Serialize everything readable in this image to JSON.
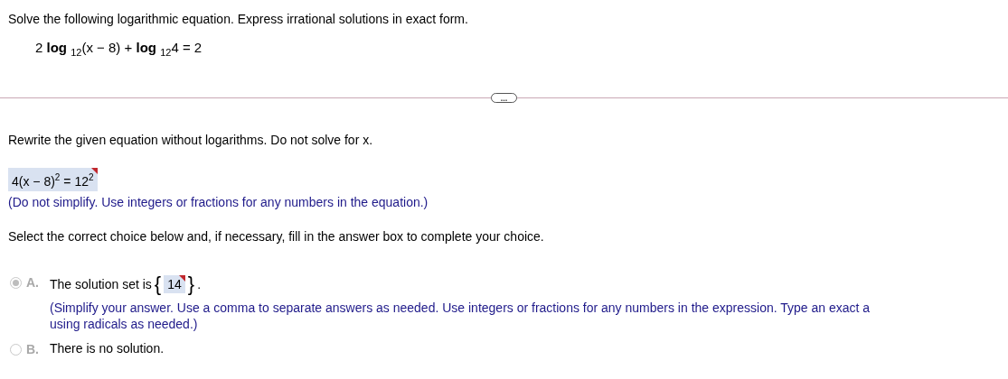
{
  "instruction": "Solve the following logarithmic equation. Express irrational solutions in exact form.",
  "equation": "2 **log** $_{12}$(x − 8) + **log** $_{12}$4 = 2",
  "divider": {
    "label": "..."
  },
  "step": {
    "prompt": "Rewrite the given equation without logarithms. Do not solve for x.",
    "answer": "4(x − 8)$^{2}$ = 12$^{2}$",
    "answer_flagged": true,
    "hint": "(Do not simplify. Use integers or fractions for any numbers in the equation.)"
  },
  "choice_prompt": "Select the correct choice below and, if necessary, fill in the answer box to complete your choice.",
  "choices": [
    {
      "letter": "A.",
      "text": "The solution set is",
      "open_brace": "{",
      "answer": "14",
      "close_brace": "}",
      "end": ".",
      "answer_flagged": true,
      "hint_lines": [
        "(Simplify your answer. Use a comma to separate answers as needed. Use integers or fractions for any numbers in the expression. Type an exact a",
        "using radicals as needed.)"
      ],
      "selected": true
    },
    {
      "letter": "B.",
      "text": "There is no solution.",
      "selected": false
    }
  ]
}
